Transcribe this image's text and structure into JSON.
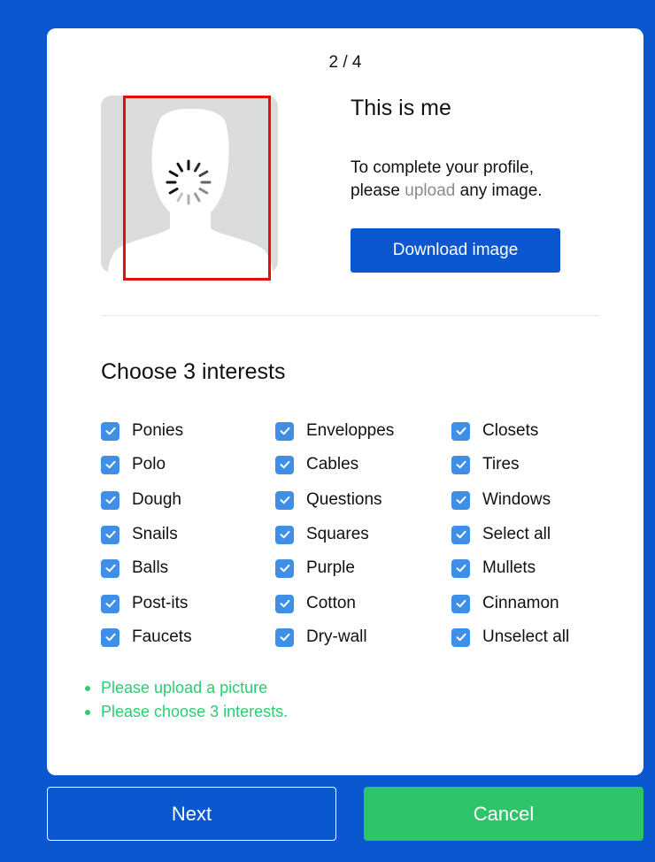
{
  "step_indicator": "2 / 4",
  "profile": {
    "heading": "This is me",
    "desc_line1": "To complete your profile,",
    "desc_prefix": "please ",
    "desc_link": "upload",
    "desc_suffix": " any image.",
    "download_button": "Download image"
  },
  "interests": {
    "title": "Choose 3 interests",
    "checkbox_color": "#3f8fe6",
    "columns": [
      [
        {
          "label": "Ponies",
          "checked": true
        },
        {
          "label": "Polo",
          "checked": true
        },
        {
          "label": "Dough",
          "checked": true
        },
        {
          "label": "Snails",
          "checked": true
        },
        {
          "label": "Balls",
          "checked": true
        },
        {
          "label": "Post-its",
          "checked": true
        },
        {
          "label": "Faucets",
          "checked": true
        }
      ],
      [
        {
          "label": "Enveloppes",
          "checked": true
        },
        {
          "label": "Cables",
          "checked": true
        },
        {
          "label": "Questions",
          "checked": true
        },
        {
          "label": "Squares",
          "checked": true
        },
        {
          "label": "Purple",
          "checked": true
        },
        {
          "label": "Cotton",
          "checked": true
        },
        {
          "label": "Dry-wall",
          "checked": true
        }
      ],
      [
        {
          "label": "Closets",
          "checked": true
        },
        {
          "label": "Tires",
          "checked": true
        },
        {
          "label": "Windows",
          "checked": true
        },
        {
          "label": "Select all",
          "checked": true
        },
        {
          "label": "Mullets",
          "checked": true
        },
        {
          "label": "Cinnamon",
          "checked": true
        },
        {
          "label": "Unselect all",
          "checked": true
        }
      ]
    ]
  },
  "errors": [
    "Please upload a picture",
    "Please choose 3 interests."
  ],
  "footer": {
    "next_label": "Next",
    "cancel_label": "Cancel"
  },
  "colors": {
    "background": "#0b57d0",
    "accent": "#0b57d0",
    "success": "#2ec46a",
    "error_text": "#2ecc71",
    "highlight_frame": "#e30f0f"
  }
}
